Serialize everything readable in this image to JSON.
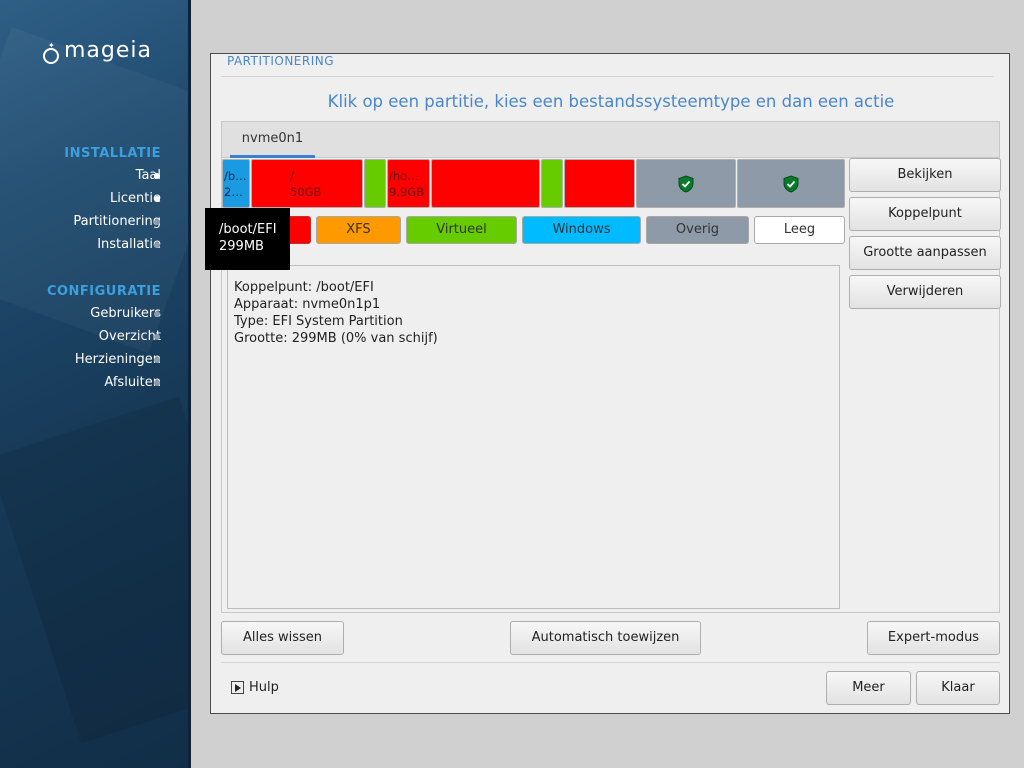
{
  "sidebar": {
    "logo_text": "mageia",
    "section_install": "INSTALLATIE",
    "install_items": [
      {
        "label": "Taal",
        "done": true
      },
      {
        "label": "Licentie",
        "done": true
      },
      {
        "label": "Partitionering",
        "done": false
      },
      {
        "label": "Installatie",
        "done": false
      }
    ],
    "section_config": "CONFIGURATIE",
    "config_items": [
      {
        "label": "Gebruikers",
        "done": false
      },
      {
        "label": "Overzicht",
        "done": false
      },
      {
        "label": "Herzieningen",
        "done": false
      },
      {
        "label": "Afsluiten",
        "done": false
      }
    ]
  },
  "window": {
    "section_label": "PARTITIONERING",
    "heading": "Klik op een partitie, kies een bestandssysteemtype en dan een actie",
    "disk_tab": "nvme0n1",
    "partitions": [
      {
        "type": "efi",
        "label1": "/b…",
        "label2": "2…"
      },
      {
        "type": "ext4",
        "label1": "/",
        "label2": "50GB"
      },
      {
        "type": "swap",
        "label1": "",
        "label2": ""
      },
      {
        "type": "ext4",
        "label1": "/ho…",
        "label2": "9.9GB"
      },
      {
        "type": "ext4",
        "label1": "",
        "label2": ""
      },
      {
        "type": "swap",
        "label1": "",
        "label2": ""
      },
      {
        "type": "ext4",
        "label1": "",
        "label2": ""
      },
      {
        "type": "other",
        "icon": "shield-icon"
      },
      {
        "type": "other",
        "icon": "shield-icon"
      }
    ],
    "legend": [
      {
        "label": "XFS",
        "color": "#ff9900"
      },
      {
        "label": "Virtueel",
        "color": "#66cc00"
      },
      {
        "label": "Windows",
        "color": "#00bbff"
      },
      {
        "label": "Overig",
        "color": "#8e9aa8"
      },
      {
        "label": "Leeg",
        "color": "#ffffff"
      }
    ],
    "legend_first_color": "#ff0000",
    "details": {
      "mount": "Koppelpunt: /boot/EFI",
      "device": "Apparaat: nvme0n1p1",
      "type": "Type: EFI System Partition",
      "size": "Grootte: 299MB (0% van schijf)"
    },
    "actions": {
      "view": "Bekijken",
      "mount": "Koppelpunt",
      "resize": "Grootte aanpassen",
      "delete": "Verwijderen"
    },
    "buttons": {
      "clear_all": "Alles wissen",
      "auto_allocate": "Automatisch toewijzen",
      "expert": "Expert-modus",
      "more": "Meer",
      "done": "Klaar"
    },
    "help": "Hulp",
    "tooltip": {
      "line1": "/boot/EFI",
      "line2": "299MB"
    }
  },
  "colors": {
    "accent": "#4a86c8",
    "sidebar_section": "#3aa0e0",
    "ext4": "#ff0000",
    "swap": "#66cc00",
    "efi": "#1a9ae0",
    "other": "#8e9aa8"
  }
}
